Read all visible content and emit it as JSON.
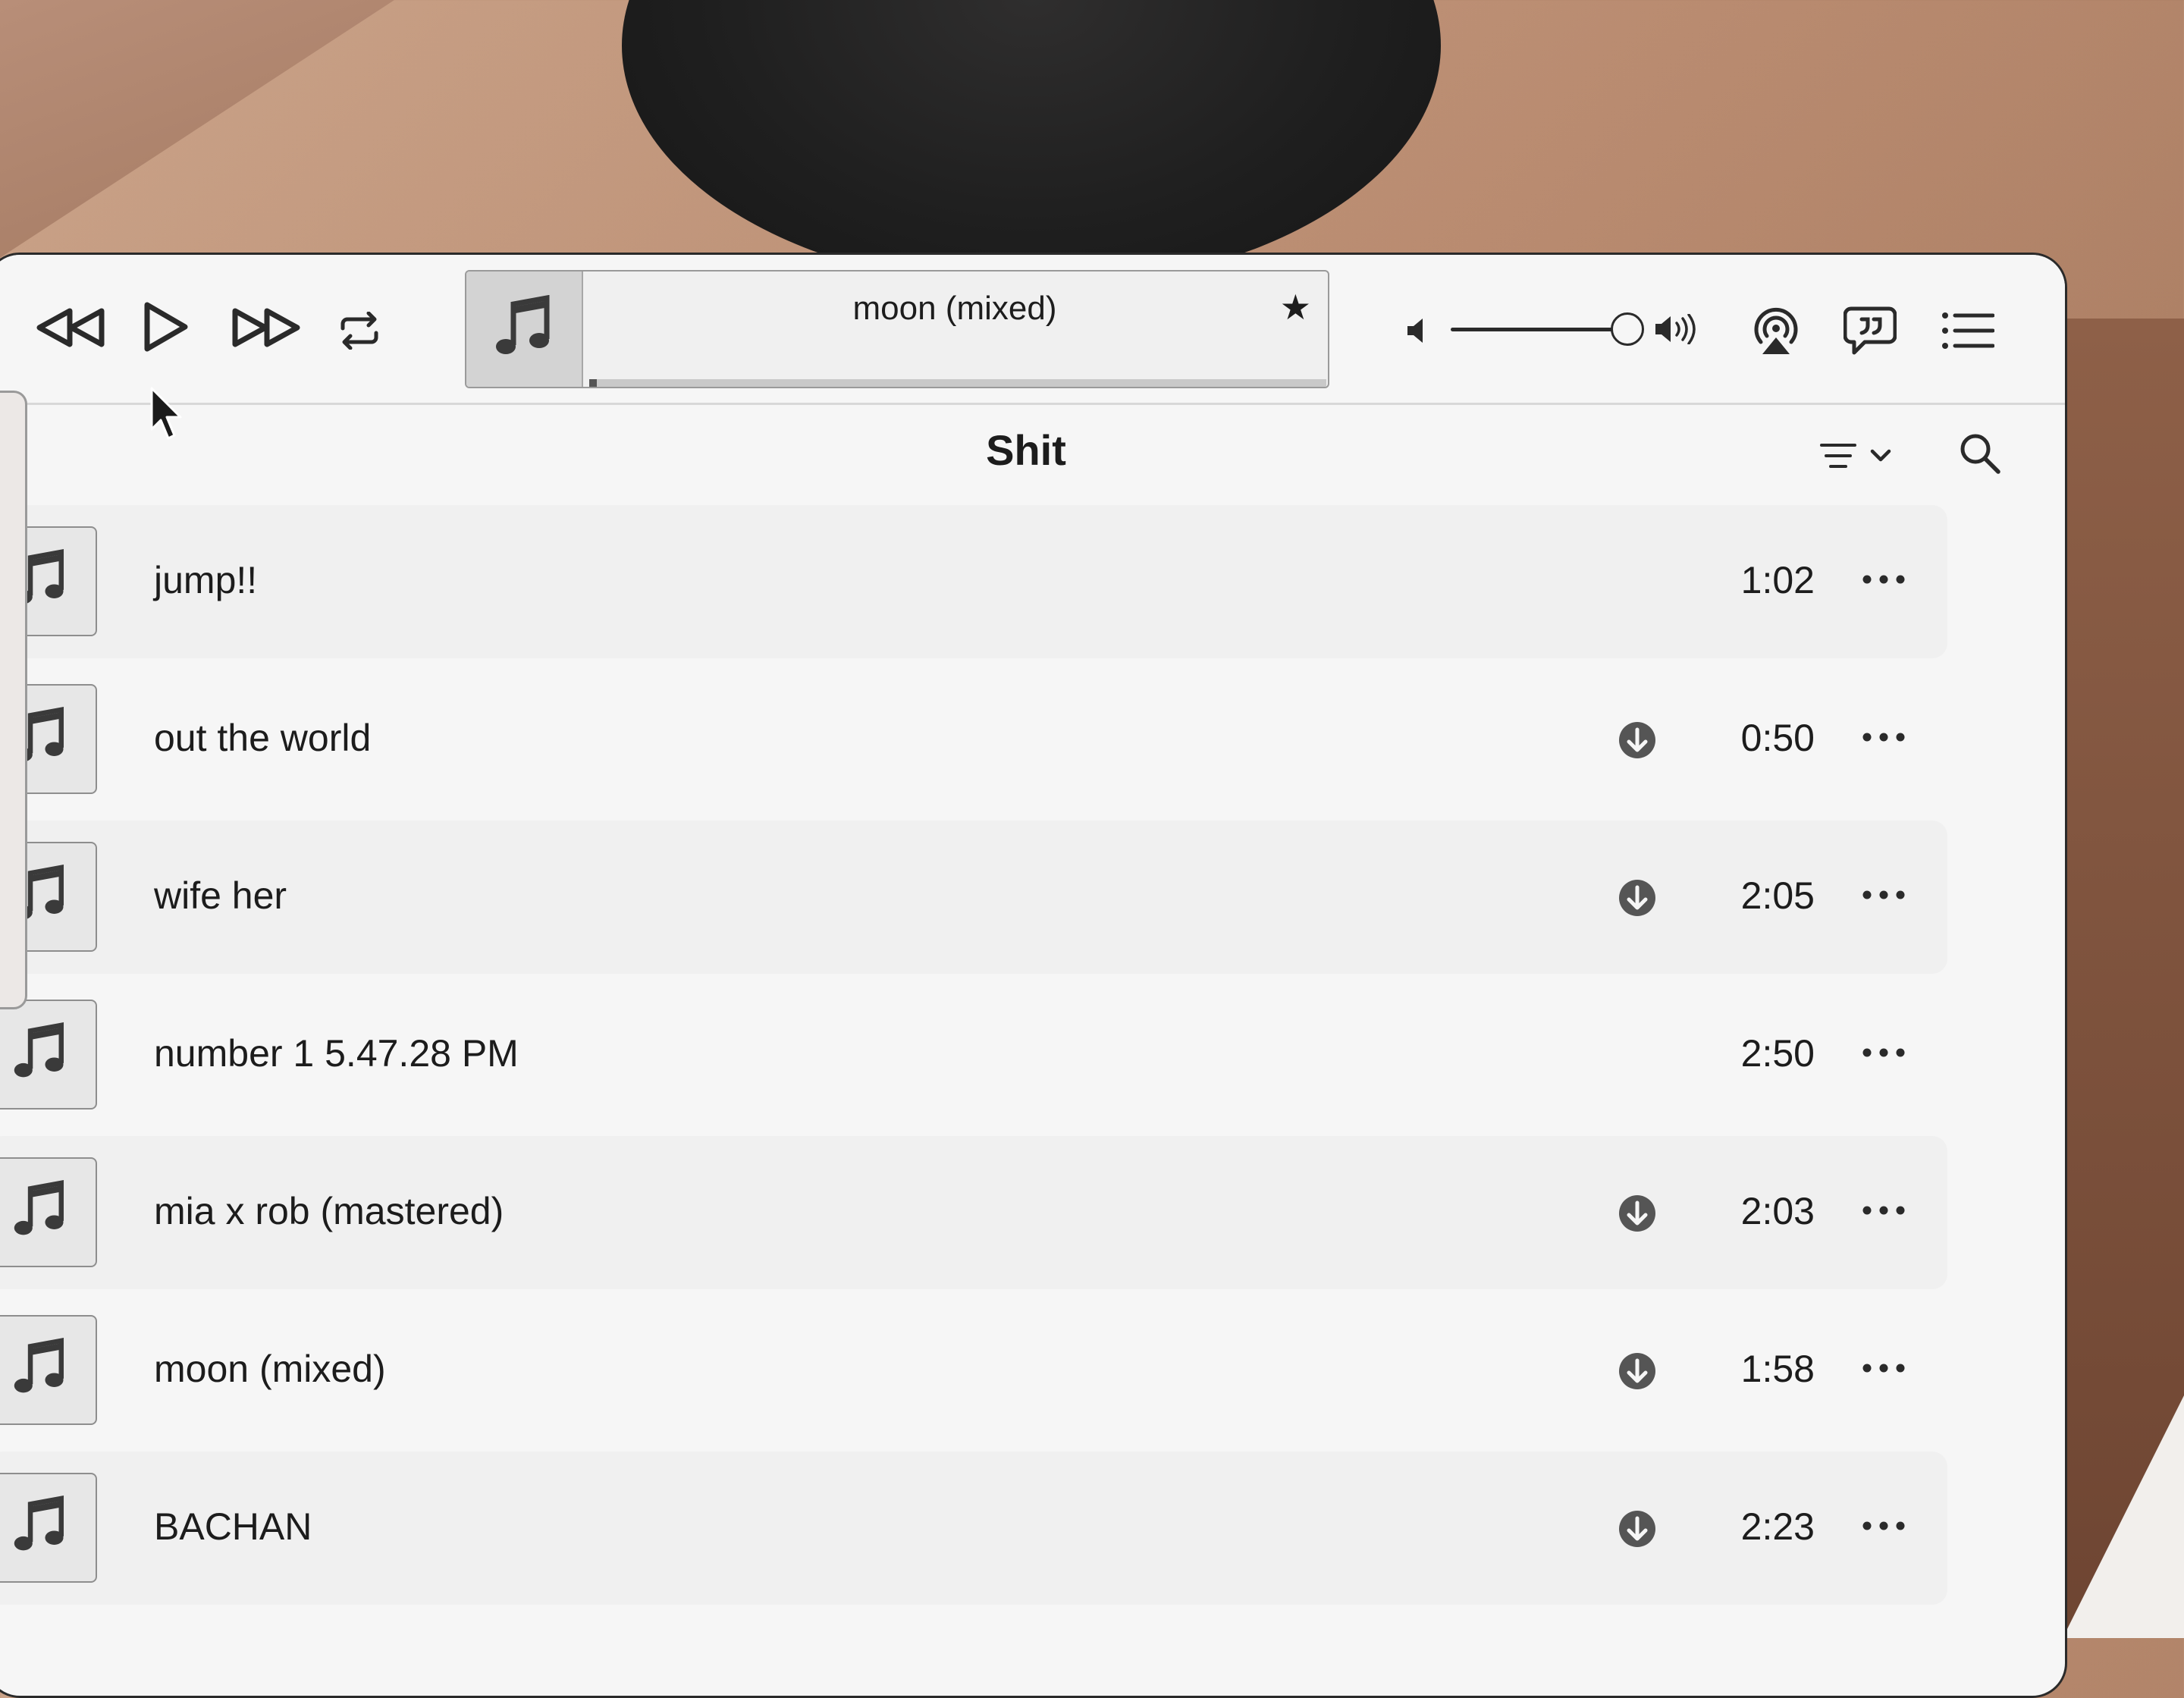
{
  "player": {
    "now_playing": "moon (mixed)",
    "progress": 0.01,
    "volume": 0.88
  },
  "playlist": {
    "title": "Shit"
  },
  "tracks": [
    {
      "title": "jump!!",
      "duration": "1:02",
      "downloadable": false
    },
    {
      "title": "out the world",
      "duration": "0:50",
      "downloadable": true
    },
    {
      "title": "wife her",
      "duration": "2:05",
      "downloadable": true
    },
    {
      "title": "number 1 5.47.28 PM",
      "duration": "2:50",
      "downloadable": false
    },
    {
      "title": "mia x rob (mastered)",
      "duration": "2:03",
      "downloadable": true
    },
    {
      "title": "moon (mixed)",
      "duration": "1:58",
      "downloadable": true
    },
    {
      "title": "BACHAN",
      "duration": "2:23",
      "downloadable": true
    }
  ],
  "icons": {
    "rewind": "rewind-icon",
    "play": "play-icon",
    "forward": "fast-forward-icon",
    "repeat": "repeat-icon",
    "star": "star-icon",
    "volume_low": "volume-low-icon",
    "volume_high": "volume-high-icon",
    "airplay": "airplay-icon",
    "lyrics": "lyrics-icon",
    "queue": "queue-list-icon",
    "sort": "sort-icon",
    "search": "search-icon",
    "download": "download-icon",
    "more": "more-icon",
    "note": "music-note-icon"
  },
  "colors": {
    "window_bg": "#f6f6f6",
    "text": "#1c1c1c",
    "row_alt": "#f0f0f0"
  }
}
